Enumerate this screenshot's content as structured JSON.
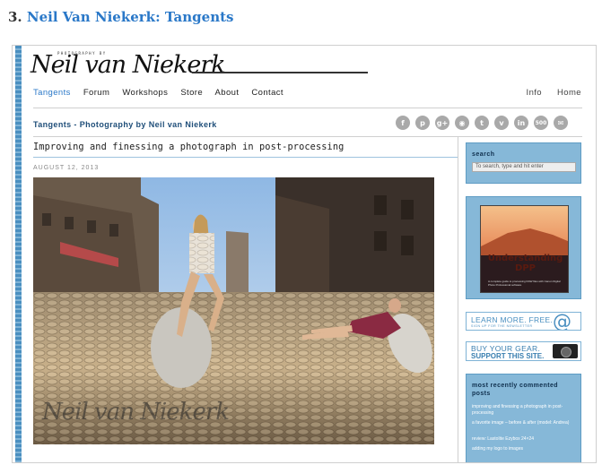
{
  "heading": {
    "number": "3.",
    "link_text": "Neil Van Niekerk: Tangents"
  },
  "logo": {
    "top_text": "PHOTOGRAPHY BY",
    "name": "Neil van Niekerk"
  },
  "nav": {
    "items": [
      "Tangents",
      "Forum",
      "Workshops",
      "Store",
      "About",
      "Contact"
    ],
    "right_items": [
      "Info",
      "Home"
    ]
  },
  "site_title": "Tangents - Photography by Neil van Niekerk",
  "social_icons": [
    {
      "icon": "facebook-icon",
      "glyph": "f"
    },
    {
      "icon": "pinterest-icon",
      "glyph": "p"
    },
    {
      "icon": "google-plus-icon",
      "glyph": "g+"
    },
    {
      "icon": "rss-icon",
      "glyph": "◉"
    },
    {
      "icon": "twitter-icon",
      "glyph": "t"
    },
    {
      "icon": "vimeo-icon",
      "glyph": "v"
    },
    {
      "icon": "linkedin-icon",
      "glyph": "in"
    },
    {
      "icon": "500px-icon",
      "glyph": "500"
    },
    {
      "icon": "email-icon",
      "glyph": "✉"
    }
  ],
  "post": {
    "title": "Improving and finessing a photograph in post-processing",
    "date": "AUGUST 12, 2013",
    "watermark": "Neil van Niekerk"
  },
  "sidebar": {
    "search_label": "search",
    "search_placeholder": "To search, type and hit enter",
    "book_title": "Understanding DPP",
    "book_subtitle": "A complete guide to processing RAW files with Canon Digital Photo Professional software",
    "newsletter_line1": "LEARN MORE. FREE.",
    "newsletter_line2": "SIGN UP FOR THE NEWSLETTER",
    "gear_line1": "BUY YOUR GEAR.",
    "gear_line2": "SUPPORT THIS SITE.",
    "recent_title": "most recently commented posts",
    "recent_items": [
      "improving and finessing a photograph in post-processing",
      "a favorite image – before & after (model: Andrea)",
      "review: Lastolite Ezybox 24×24",
      "adding my logo to images"
    ]
  },
  "colors": {
    "accent": "#2a78c8",
    "sidebar_box": "#86b8d8",
    "dark_blue": "#1f4e79"
  }
}
